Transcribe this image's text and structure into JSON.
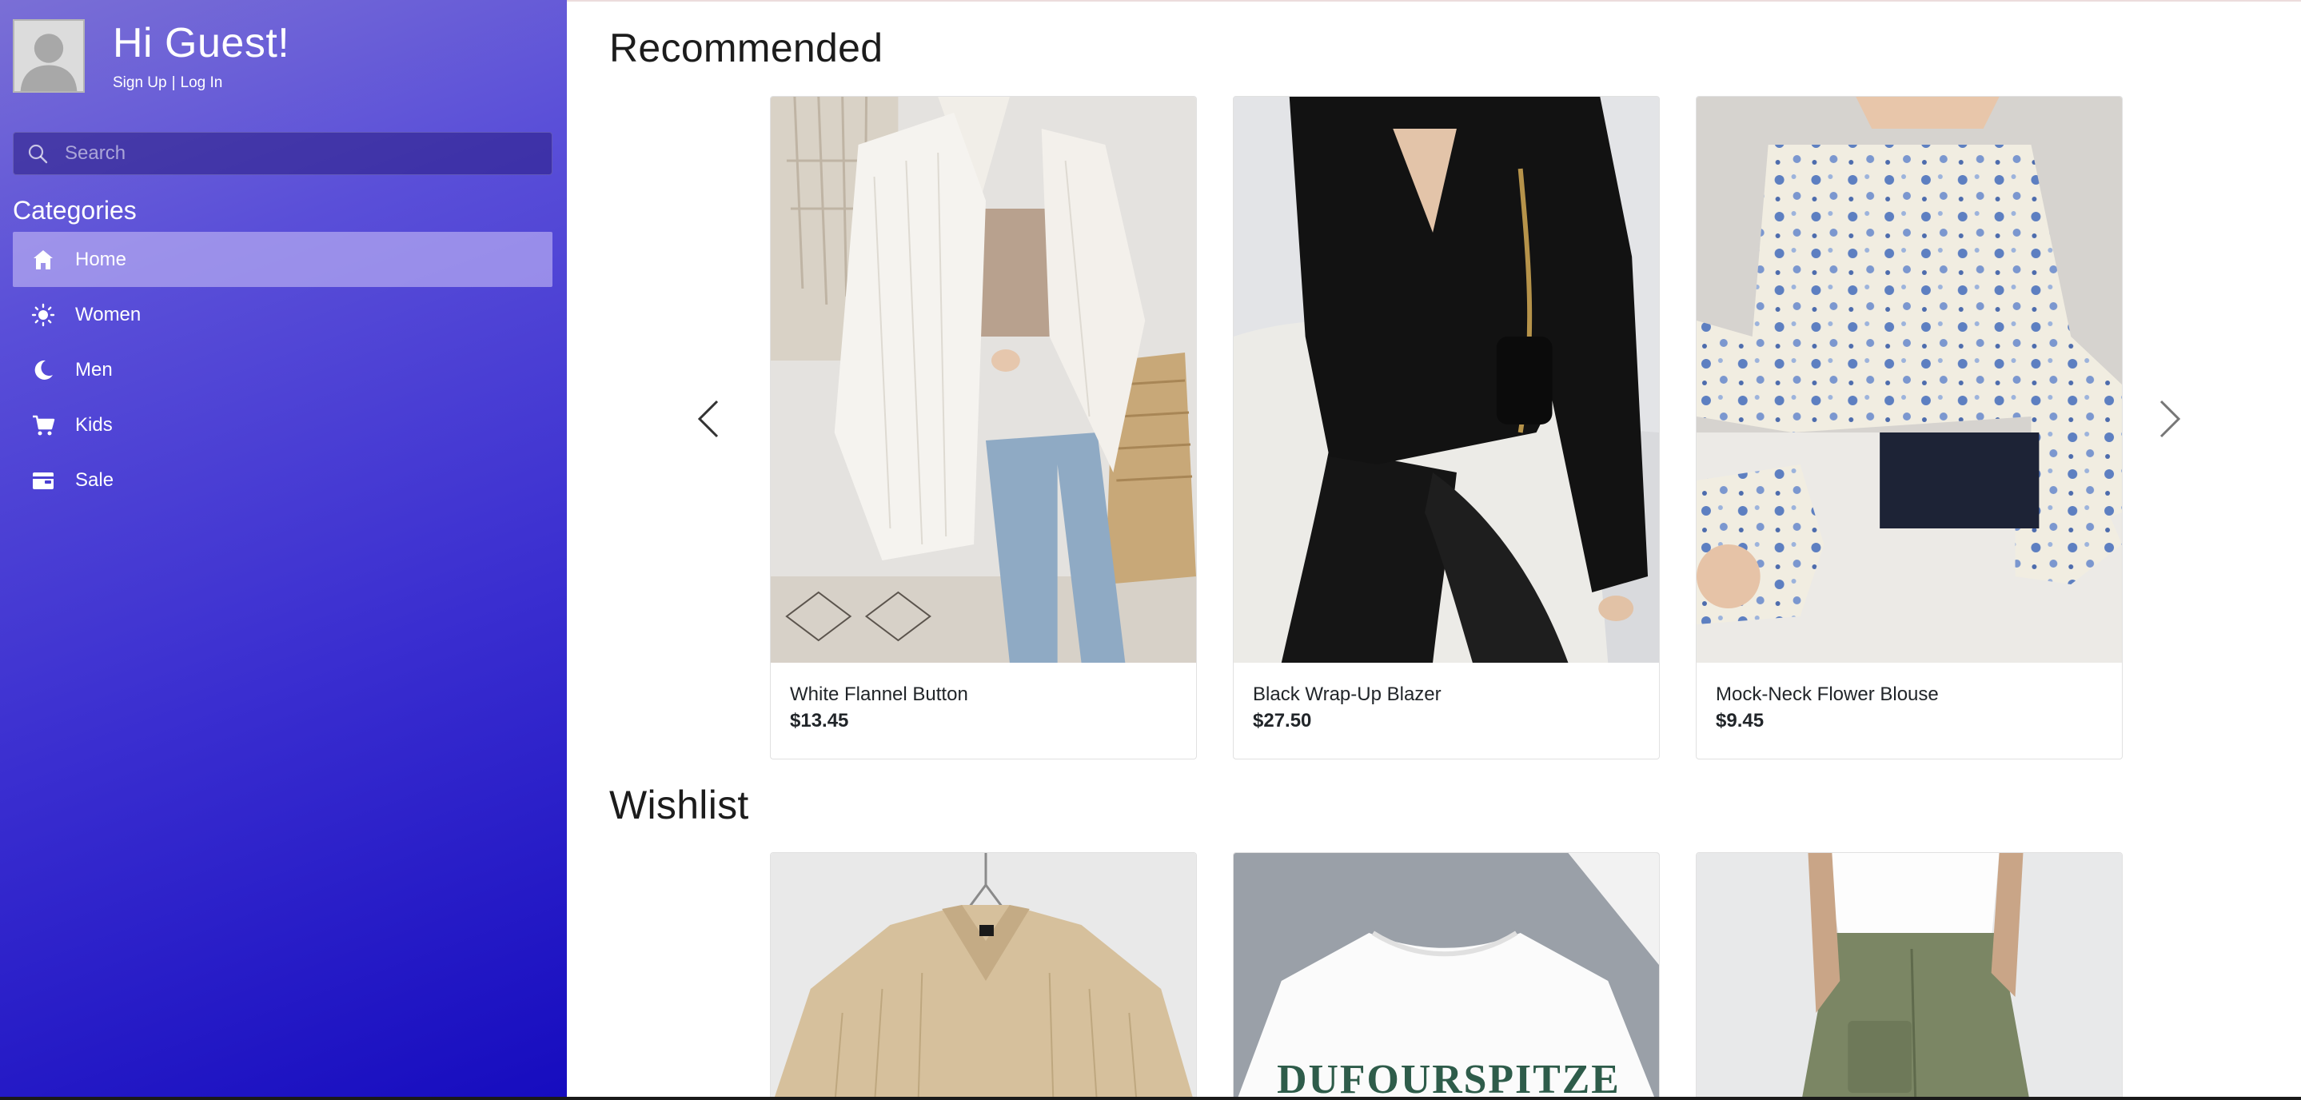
{
  "sidebar": {
    "greeting": "Hi Guest!",
    "sign_up_label": "Sign Up",
    "separator": "|",
    "log_in_label": "Log In",
    "search": {
      "placeholder": "Search"
    },
    "categories_title": "Categories",
    "items": [
      {
        "label": "Home",
        "icon": "home-icon",
        "active": true
      },
      {
        "label": "Women",
        "icon": "sun-icon",
        "active": false
      },
      {
        "label": "Men",
        "icon": "moon-icon",
        "active": false
      },
      {
        "label": "Kids",
        "icon": "cart-icon",
        "active": false
      },
      {
        "label": "Sale",
        "icon": "wallet-icon",
        "active": false
      }
    ]
  },
  "recommended": {
    "title": "Recommended",
    "products": [
      {
        "name": "White Flannel Button",
        "price": "$13.45"
      },
      {
        "name": "Black Wrap-Up Blazer",
        "price": "$27.50"
      },
      {
        "name": "Mock-Neck Flower Blouse",
        "price": "$9.45"
      }
    ]
  },
  "wishlist": {
    "title": "Wishlist",
    "products": [
      {
        "image": "beige-shirt"
      },
      {
        "image": "white-graphic-tee",
        "graphic_text": "DUFOURSPITZE"
      },
      {
        "image": "green-cargo-pants"
      }
    ]
  },
  "colors": {
    "sidebar_top": "#7a6fd6",
    "sidebar_bottom": "#160cbf",
    "active_item": "#a79ff0"
  }
}
